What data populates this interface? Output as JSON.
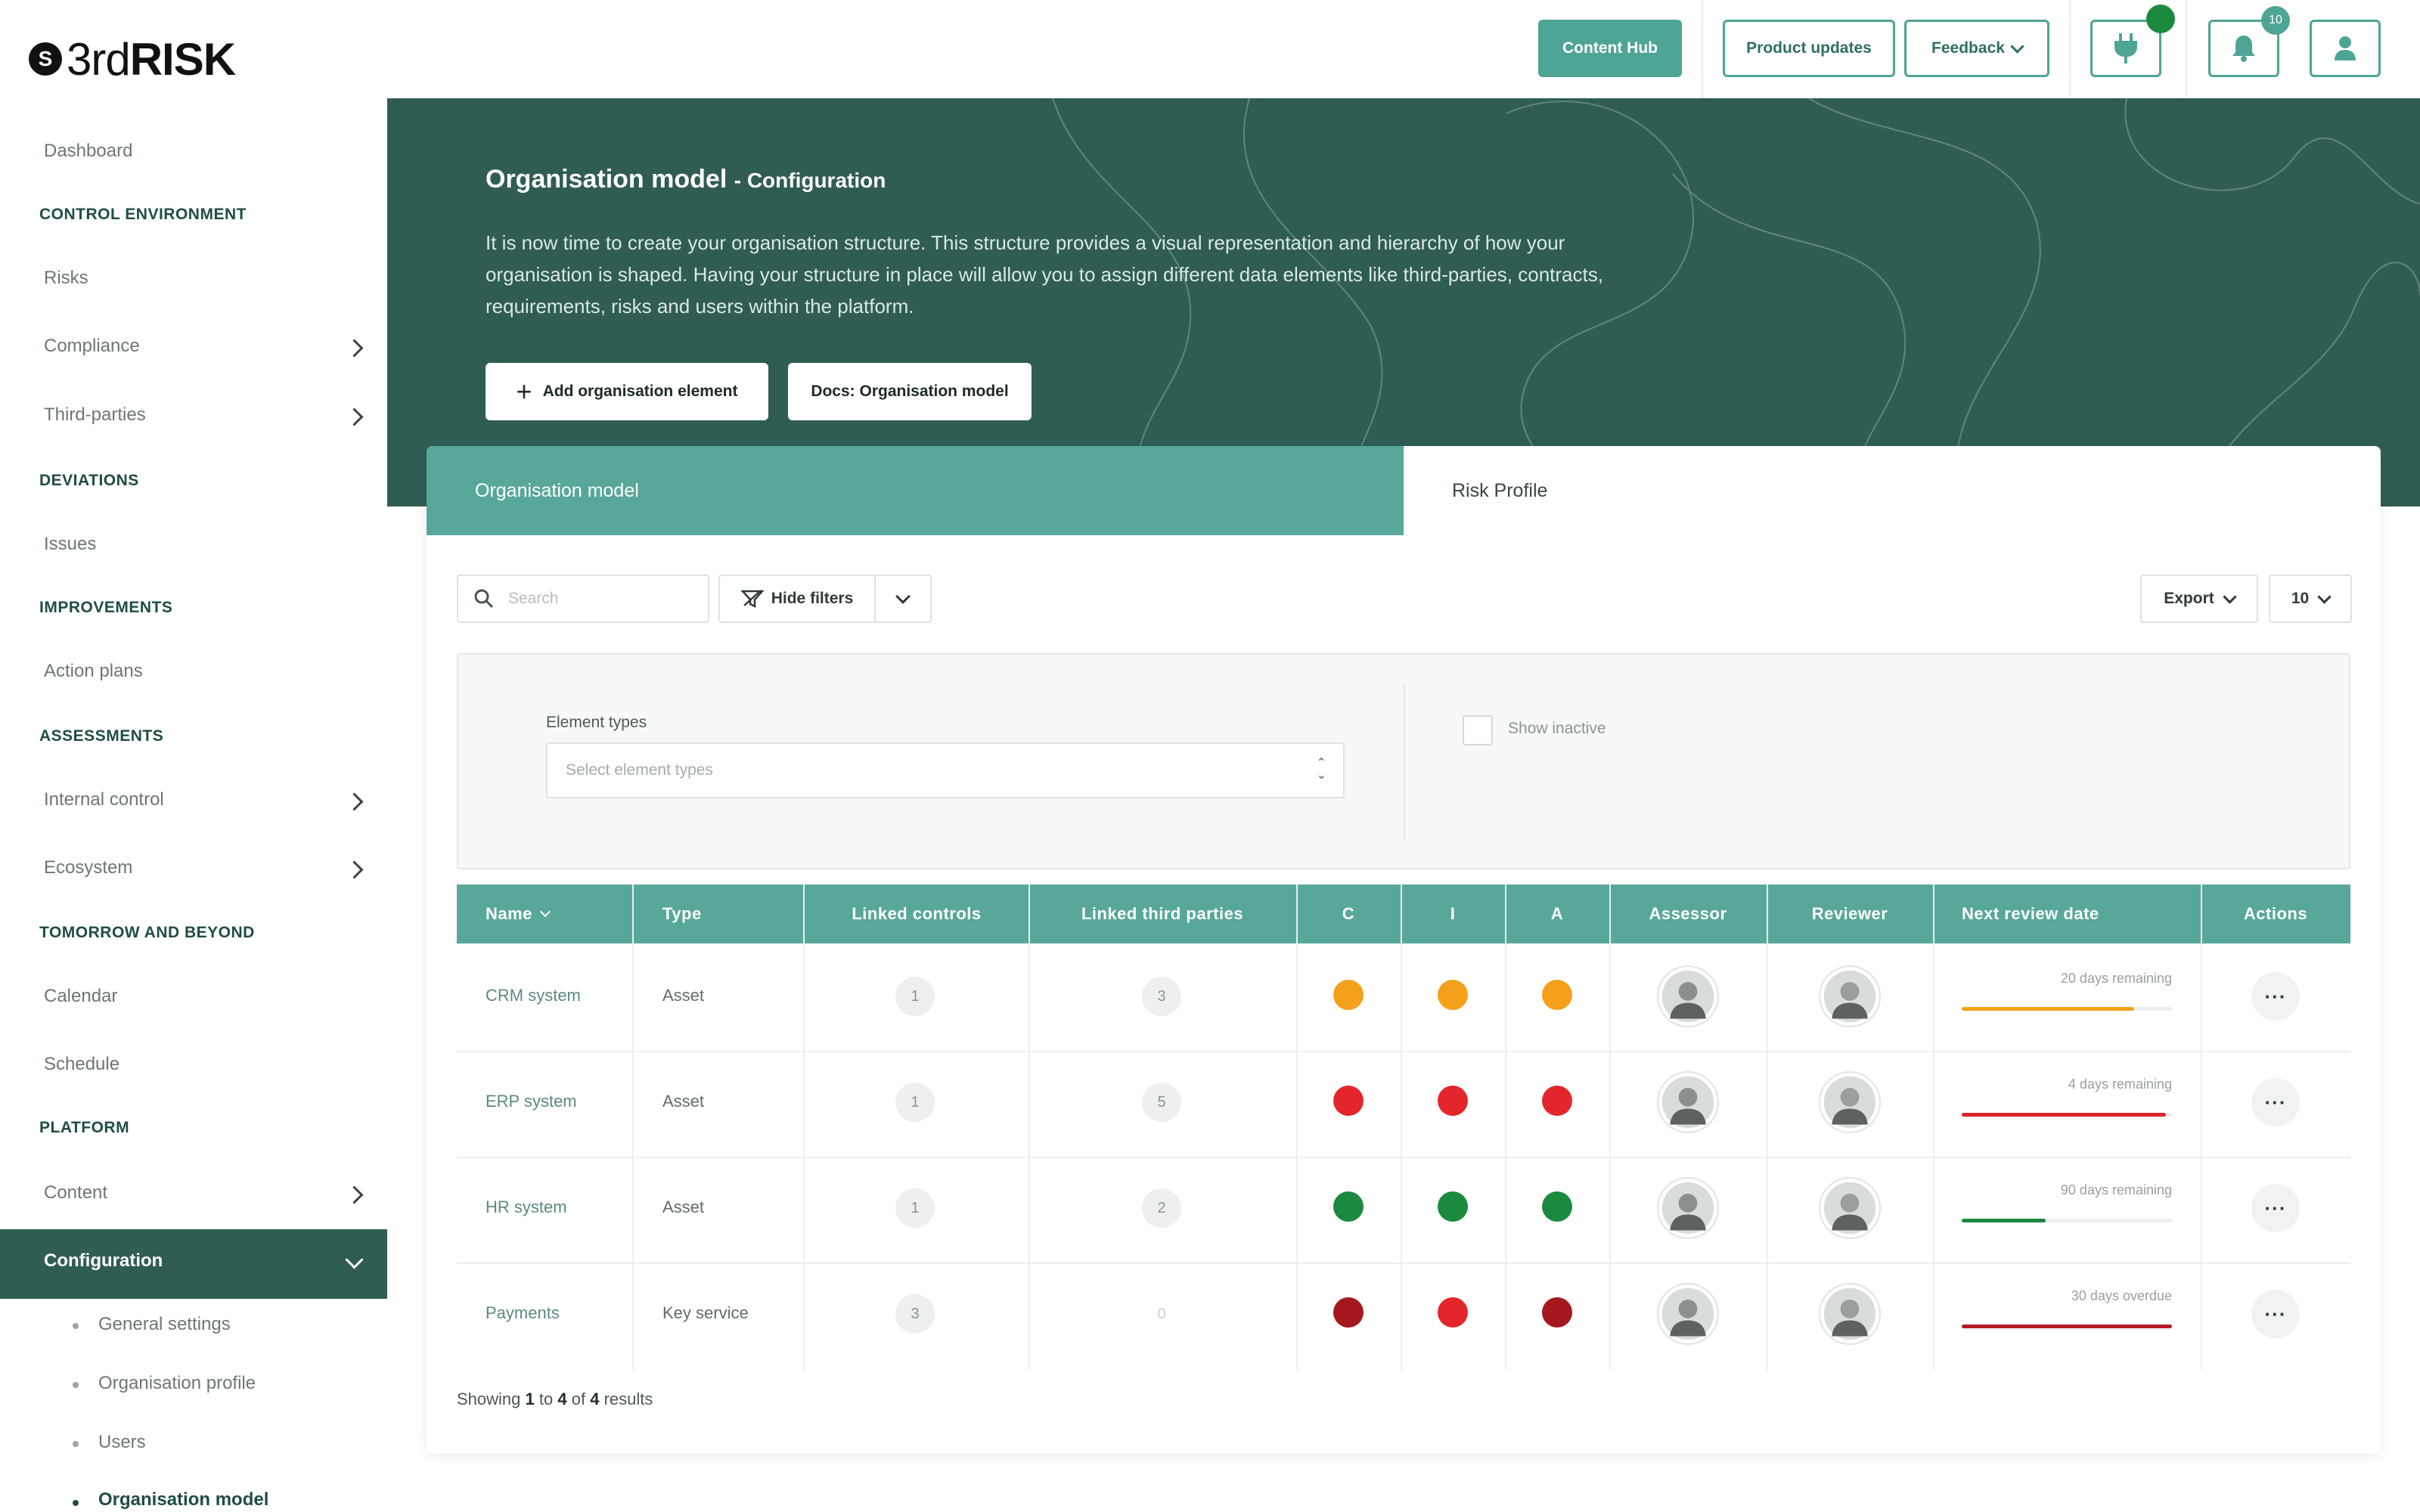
{
  "app": {
    "brand_number": "3rd",
    "brand_word": "RISK",
    "logo_glyph": "S"
  },
  "topbar": {
    "content_hub": "Content Hub",
    "product_updates": "Product updates",
    "feedback": "Feedback",
    "notifications_count": "10"
  },
  "sidebar": {
    "dashboard": "Dashboard",
    "control_environment": "CONTROL ENVIRONMENT",
    "risks": "Risks",
    "compliance": "Compliance",
    "third_parties": "Third-parties",
    "deviations": "DEVIATIONS",
    "issues": "Issues",
    "improvements": "IMPROVEMENTS",
    "action_plans": "Action plans",
    "assessments": "ASSESSMENTS",
    "internal_control": "Internal control",
    "ecosystem": "Ecosystem",
    "tomorrow": "TOMORROW AND BEYOND",
    "calendar": "Calendar",
    "schedule": "Schedule",
    "platform": "PLATFORM",
    "content": "Content",
    "configuration": "Configuration",
    "sub": [
      "General settings",
      "Organisation profile",
      "Users",
      "Organisation model"
    ]
  },
  "banner": {
    "title": "Organisation model",
    "subtitle": "- Configuration",
    "text": "It is now time to create your organisation structure. This structure provides a visual representation and hierarchy of how your organisation is shaped. Having your structure in place will allow you to assign different data elements like third-parties, contracts, requirements, risks and users within the platform.",
    "add_button": "Add organisation element",
    "docs_button": "Docs: Organisation model"
  },
  "tabs": {
    "active": "Organisation model",
    "inactive": "Risk Profile"
  },
  "toolbar": {
    "search_placeholder": "Search",
    "hide_filters": "Hide filters",
    "export": "Export",
    "page_size": "10"
  },
  "filters": {
    "element_types_label": "Element types",
    "element_types_placeholder": "Select element types",
    "show_inactive": "Show inactive"
  },
  "table": {
    "headers": {
      "name": "Name",
      "type": "Type",
      "linked_controls": "Linked controls",
      "linked_third_parties": "Linked third parties",
      "c": "C",
      "i": "I",
      "a": "A",
      "assessor": "Assessor",
      "reviewer": "Reviewer",
      "next_review": "Next review date",
      "actions": "Actions"
    },
    "rows": [
      {
        "name": "CRM system",
        "type": "Asset",
        "controls": "1",
        "third_parties": "3",
        "c": "#f5a01a",
        "i": "#f5a01a",
        "a": "#f5a01a",
        "review": "20 days remaining",
        "progress": 0.82,
        "progress_color": "#f5a01a"
      },
      {
        "name": "ERP system",
        "type": "Asset",
        "controls": "1",
        "third_parties": "5",
        "c": "#e2262b",
        "i": "#e2262b",
        "a": "#e2262b",
        "review": "4 days remaining",
        "progress": 0.97,
        "progress_color": "#d9262b"
      },
      {
        "name": "HR system",
        "type": "Asset",
        "controls": "1",
        "third_parties": "2",
        "c": "#1b8a3e",
        "i": "#1b8a3e",
        "a": "#1b8a3e",
        "review": "90 days remaining",
        "progress": 0.4,
        "progress_color": "#1b8a3e"
      },
      {
        "name": "Payments",
        "type": "Key service",
        "controls": "3",
        "third_parties": "0",
        "c": "#a5181e",
        "i": "#e2262b",
        "a": "#a5181e",
        "review": "30 days overdue",
        "progress": 1.0,
        "progress_color": "#b51a21"
      }
    ]
  },
  "footer": {
    "showing": "Showing",
    "from": "1",
    "to_word": "to",
    "to": "4",
    "of_word": "of",
    "total": "4",
    "results": "results"
  }
}
